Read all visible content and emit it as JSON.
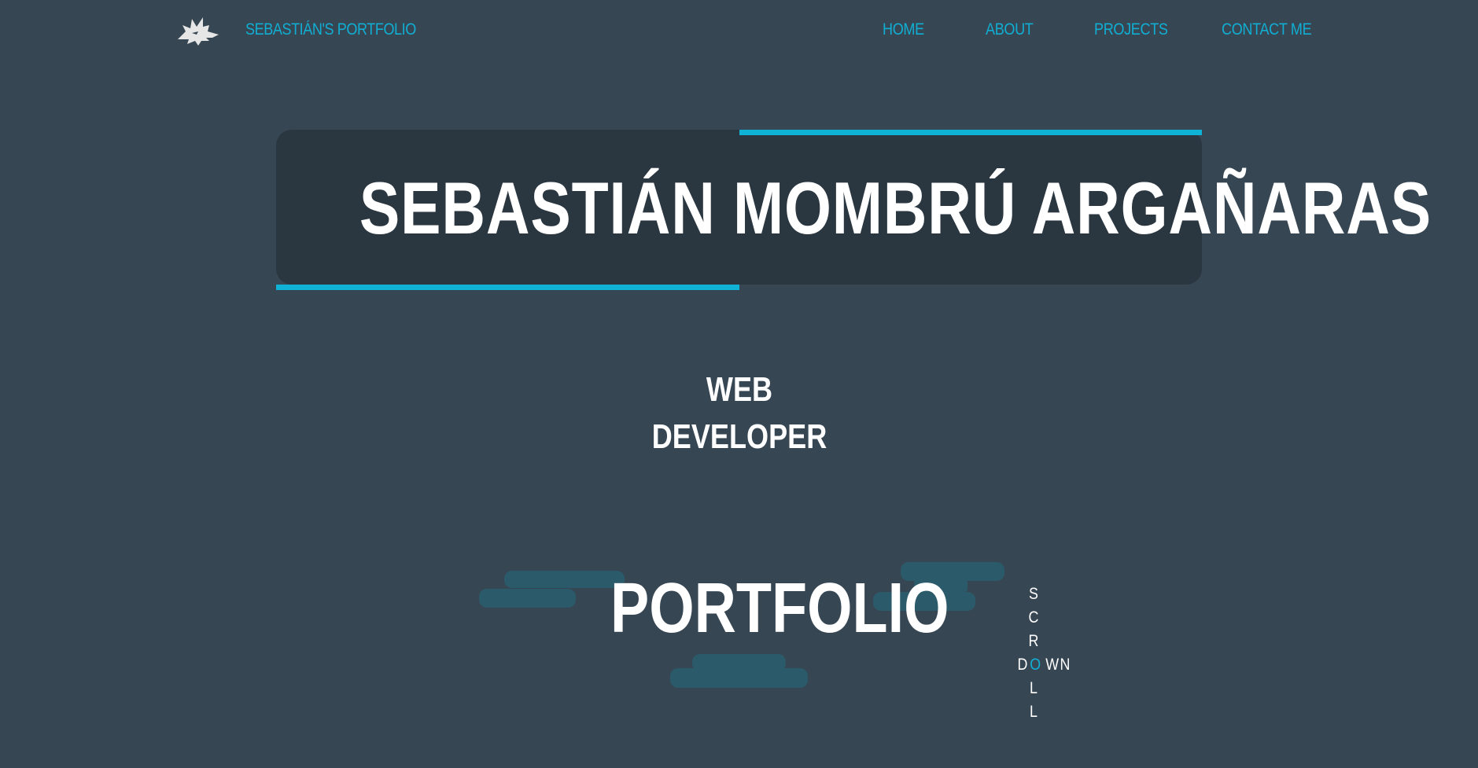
{
  "nav": {
    "logo_icon": "wolf-head-icon",
    "brand": "SEBASTIÁN'S PORTFOLIO",
    "links": [
      "HOME",
      "ABOUT",
      "PROJECTS",
      "CONTACT ME"
    ]
  },
  "hero": {
    "name": "SEBASTIÁN MOMBRÚ ARGAÑARAS",
    "role_line1": "WEB",
    "role_line2": "DEVELOPER"
  },
  "portfolio": {
    "title": "PORTFOLIO"
  },
  "scroll": {
    "vertical": [
      "S",
      "C",
      "R",
      "O",
      "L",
      "L"
    ],
    "horizontal": [
      "D",
      "O",
      "W",
      "N"
    ],
    "shared_letter": "O"
  },
  "colors": {
    "background": "#374653",
    "panel": "#2a3640",
    "accent": "#11aed3",
    "text": "#ffffff",
    "cloud": "#2b5a6a"
  }
}
